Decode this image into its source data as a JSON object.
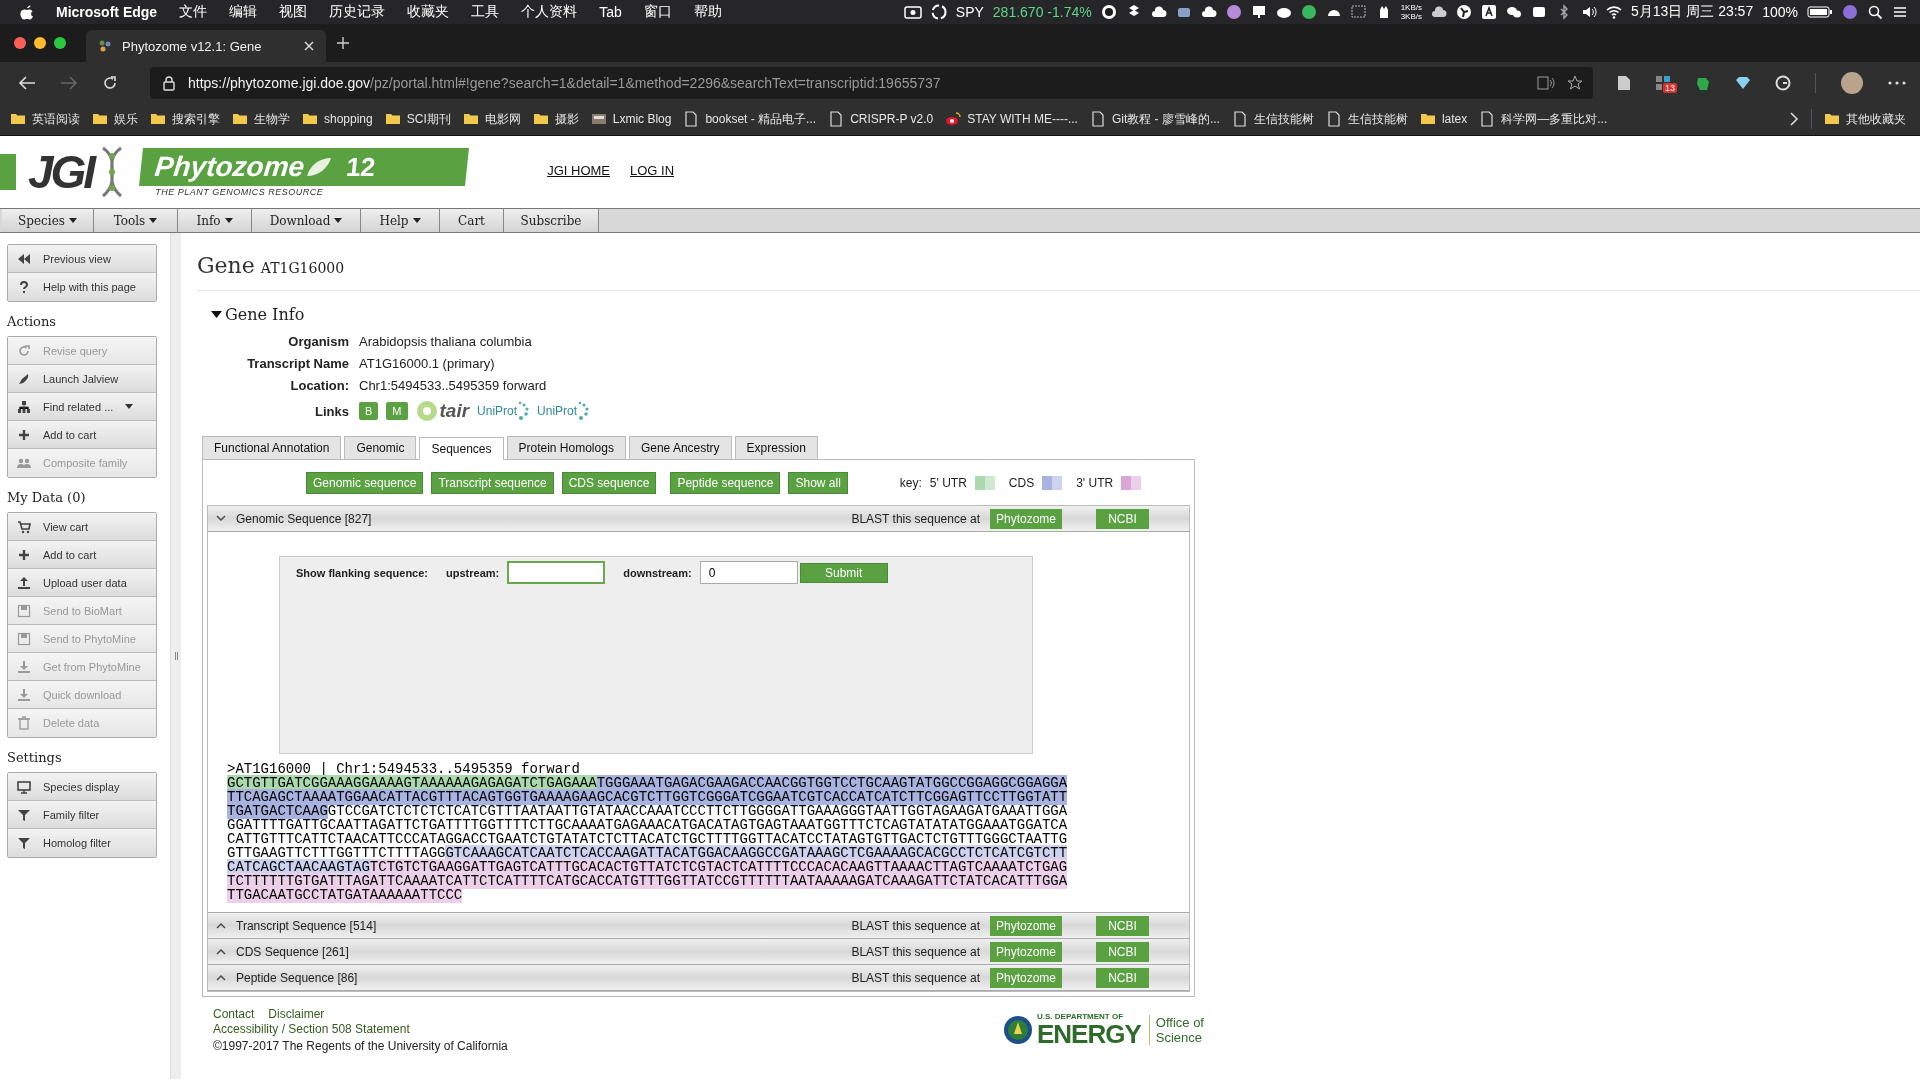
{
  "menubar": {
    "app": "Microsoft Edge",
    "menus": [
      "文件",
      "编辑",
      "视图",
      "历史记录",
      "收藏夹",
      "工具",
      "个人资料",
      "Tab",
      "窗口",
      "帮助"
    ],
    "stock_symbol": "SPY",
    "stock_quote": "281.670 -1.74%",
    "net_up": "1KB/s",
    "net_down": "3KB/s",
    "clock": "5月13日 周三 23:57",
    "battery": "100%"
  },
  "browser": {
    "tabs": [
      {
        "title": "Phytozome v12.1: Gene",
        "selected": true
      }
    ],
    "url_host": "https://phytozome.jgi.doe.gov",
    "url_path": "/pz/portal.html#!gene?search=1&detail=1&method=2296&searchText=transcriptid:19655737",
    "extension_badge": "13",
    "bookmarks": [
      {
        "label": "英语阅读",
        "kind": "folder"
      },
      {
        "label": "娱乐",
        "kind": "folder"
      },
      {
        "label": "搜索引擎",
        "kind": "folder"
      },
      {
        "label": "生物学",
        "kind": "folder"
      },
      {
        "label": "shopping",
        "kind": "folder"
      },
      {
        "label": "SCI期刊",
        "kind": "folder"
      },
      {
        "label": "电影网",
        "kind": "folder"
      },
      {
        "label": "摄影",
        "kind": "folder"
      },
      {
        "label": "Lxmic Blog",
        "kind": "thumbnail"
      },
      {
        "label": "bookset - 精品电子...",
        "kind": "page"
      },
      {
        "label": "CRISPR-P v2.0",
        "kind": "page"
      },
      {
        "label": "STAY WITH ME----...",
        "kind": "swirl"
      },
      {
        "label": "Git教程 - 廖雪峰的...",
        "kind": "page"
      },
      {
        "label": "生信技能树",
        "kind": "page"
      },
      {
        "label": "生信技能树",
        "kind": "page"
      },
      {
        "label": "latex",
        "kind": "folder"
      },
      {
        "label": "科学网—多重比对...",
        "kind": "page"
      }
    ],
    "other_bookmarks": "其他收藏夹"
  },
  "site": {
    "logo": "JGI",
    "product": "Phytozome",
    "version": "12",
    "tagline": "THE PLANT GENOMICS RESOURCE",
    "header_links": [
      "JGI HOME",
      "LOG IN"
    ],
    "nav": [
      {
        "label": "Species",
        "dropdown": true
      },
      {
        "label": "Tools",
        "dropdown": true
      },
      {
        "label": "Info",
        "dropdown": true
      },
      {
        "label": "Download",
        "dropdown": true
      },
      {
        "label": "Help",
        "dropdown": true
      },
      {
        "label": "Cart",
        "dropdown": false
      },
      {
        "label": "Subscribe",
        "dropdown": false
      }
    ]
  },
  "sidebar": {
    "groups": [
      {
        "items": [
          {
            "label": "Previous view",
            "disabled": false,
            "dropdown": false
          },
          {
            "label": "Help with this page",
            "disabled": false,
            "dropdown": false
          }
        ]
      },
      {
        "heading": "Actions",
        "items": [
          {
            "label": "Revise query",
            "disabled": true,
            "dropdown": false
          },
          {
            "label": "Launch Jalview",
            "disabled": false,
            "dropdown": false
          },
          {
            "label": "Find related ...",
            "disabled": false,
            "dropdown": true
          },
          {
            "label": "Add to cart",
            "disabled": false,
            "dropdown": false
          },
          {
            "label": "Composite family",
            "disabled": true,
            "dropdown": false
          }
        ]
      },
      {
        "heading": "My Data (0)",
        "items": [
          {
            "label": "View cart",
            "disabled": false,
            "dropdown": false
          },
          {
            "label": "Add to cart",
            "disabled": false,
            "dropdown": false
          },
          {
            "label": "Upload user data",
            "disabled": false,
            "dropdown": false
          },
          {
            "label": "Send to BioMart",
            "disabled": true,
            "dropdown": false
          },
          {
            "label": "Send to PhytoMine",
            "disabled": true,
            "dropdown": false
          },
          {
            "label": "Get from PhytoMine",
            "disabled": true,
            "dropdown": false
          },
          {
            "label": "Quick download",
            "disabled": true,
            "dropdown": false
          },
          {
            "label": "Delete data",
            "disabled": true,
            "dropdown": false
          }
        ]
      },
      {
        "heading": "Settings",
        "items": [
          {
            "label": "Species display",
            "disabled": false,
            "dropdown": false
          },
          {
            "label": "Family filter",
            "disabled": false,
            "dropdown": false
          },
          {
            "label": "Homolog filter",
            "disabled": false,
            "dropdown": false
          }
        ]
      }
    ]
  },
  "gene": {
    "title": "Gene",
    "id": "AT1G16000",
    "info_heading": "Gene Info",
    "info_expanded": true,
    "fields": [
      {
        "label": "Organism",
        "value": "Arabidopsis thaliana columbia"
      },
      {
        "label": "Transcript Name",
        "value": "AT1G16000.1 (primary)"
      },
      {
        "label": "Location:",
        "value": "Chr1:5494533..5495359 forward"
      }
    ],
    "links_label": "Links",
    "links": [
      {
        "kind": "badge",
        "text": "B"
      },
      {
        "kind": "badge",
        "text": "M"
      },
      {
        "kind": "tair",
        "text": "tair"
      },
      {
        "kind": "uniprot",
        "text": "UniProt"
      },
      {
        "kind": "uniprot",
        "text": "UniProt"
      }
    ],
    "tabs": [
      {
        "label": "Functional Annotation",
        "selected": false
      },
      {
        "label": "Genomic",
        "selected": false
      },
      {
        "label": "Sequences",
        "selected": true
      },
      {
        "label": "Protein Homologs",
        "selected": false
      },
      {
        "label": "Gene Ancestry",
        "selected": false
      },
      {
        "label": "Expression",
        "selected": false
      }
    ],
    "sequence_buttons": [
      "Genomic sequence",
      "Transcript sequence",
      "CDS sequence",
      "Peptide sequence",
      "Show all"
    ],
    "key_label": "key:",
    "key": [
      {
        "label": "5' UTR"
      },
      {
        "label": "CDS"
      },
      {
        "label": "3' UTR"
      }
    ],
    "sections": [
      {
        "title": "Genomic Sequence [827]",
        "expanded": true,
        "blast_label": "BLAST this sequence at",
        "buttons": [
          "Phytozome",
          "NCBI"
        ]
      },
      {
        "title": "Transcript Sequence [514]",
        "expanded": false,
        "blast_label": "BLAST this sequence at",
        "buttons": [
          "Phytozome",
          "NCBI"
        ]
      },
      {
        "title": "CDS Sequence [261]",
        "expanded": false,
        "blast_label": "BLAST this sequence at",
        "buttons": [
          "Phytozome",
          "NCBI"
        ]
      },
      {
        "title": "Peptide Sequence [86]",
        "expanded": false,
        "blast_label": "BLAST this sequence at",
        "buttons": [
          "Phytozome",
          "NCBI"
        ]
      }
    ],
    "flank": {
      "label": "Show flanking sequence:",
      "upstream_label": "upstream:",
      "upstream_focused": true,
      "downstream_label": "downstream:",
      "downstream_value": "0",
      "submit": "Submit"
    },
    "fasta_header": ">AT1G16000 | Chr1:5494533..5495359 forward",
    "sequence_lines": [
      [
        {
          "text": "GCTGTTGATCGGAAAGGAAAAGTAAAAAAGAGAGATCTGAGAAA",
          "color": "#a9d9ad"
        },
        {
          "text": "TGGGAAATGAGACGAAGACCAACGGTGGTCCTGCAAGTATGGCCGGAGGCGGAGGA",
          "color": "#a9b3e0"
        }
      ],
      [
        {
          "text": "TTCAGAGCTAAAATGGAACATTACGTTTACAGTGGTGAAAAGAAGCACGTCTTGGTCGGGATCGGAATCGTCACCATCATCTTCGGAGTTCCTTGGTATT",
          "color": "#a9b3e0"
        }
      ],
      [
        {
          "text": "TGATGACTCAAG",
          "color": "#a9b3e0"
        },
        {
          "text": "GTCCGATCTCTCTCTCATCGTTTAATAATTGTATAACCAAATCCCTTCTTGGGGATTGAAAGGGTAATTGGTAGAAGATGAAATTGGA"
        }
      ],
      [
        {
          "text": "GGATTTTGATTGCAATTAGATTCTGATTTTGGTTTTCTTGCAAAATGAGAAACATGACATAGTGAGTAAATGGTTTCTCAGTATATATGGAAATGGATCA"
        }
      ],
      [
        {
          "text": "CATTGTTTCATTCTAACATTCCCATAGGACCTGAATCTGTATATCTCTTACATCTGCTTTTGGTTACATCCTATAGTGTTGACTCTGTTTGGGCTAATTG"
        }
      ],
      [
        {
          "text": "GTTGAAGTTCTTTGGTTTCTTTTAGG"
        },
        {
          "text": "GTCAAAGCATCAATCTCACCAAGATTACATGGACAAGGCCGATAAAGCTCGAAAAGCACGCCTCTCATCGTCTT",
          "color": "#cdd3ef"
        }
      ],
      [
        {
          "text": "CATCAGCTAACAAGTAG",
          "color": "#cdd3ef"
        },
        {
          "text": "TCTGTCTGAAGGATTGAGTCATTTGCACACTGTTATCTCGTACTCATTTTCCCACACAAGTTAAAACTTAGTCAAAATCTGAG",
          "color": "#ecd0ea"
        }
      ],
      [
        {
          "text": "TCTTTTTTGTGATTTAGATTCAAAATCATTCTCATTTTCATGCACCATGTTTGGTTATCCGTTTTTTAATAAAAAGATCAAAGATTCTATCACATTTGGA",
          "color": "#ecd0ea"
        }
      ],
      [
        {
          "text": "TTGACAATGCCTATGATAAAAAATTCCC",
          "color": "#ecd0ea"
        }
      ]
    ]
  },
  "footer": {
    "links": [
      "Contact",
      "Disclaimer",
      "Accessibility / Section 508 Statement"
    ],
    "copyright": "©1997-2017 The Regents of the University of California",
    "doe_top": "U.S. DEPARTMENT OF",
    "doe_name": "ENERGY",
    "office": "Office of",
    "science": "Science"
  }
}
